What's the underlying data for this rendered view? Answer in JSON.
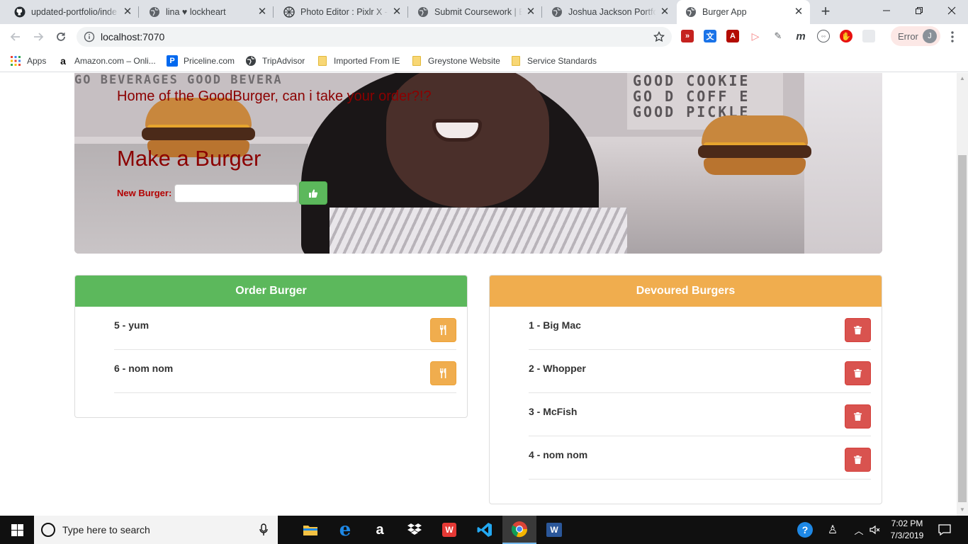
{
  "browser": {
    "tabs": [
      {
        "title": "updated-portfolio/inde",
        "favicon": "github-icon",
        "active": false
      },
      {
        "title": "lina ♥ lockheart",
        "favicon": "globe-icon",
        "active": false
      },
      {
        "title": "Photo Editor : Pixlr X - f",
        "favicon": "pixlr-icon",
        "active": false
      },
      {
        "title": "Submit Coursework | Bo",
        "favicon": "globe-icon",
        "active": false
      },
      {
        "title": "Joshua Jackson Portfoli",
        "favicon": "globe-icon",
        "active": false
      },
      {
        "title": "Burger App",
        "favicon": "globe-icon",
        "active": true
      }
    ],
    "new_tab": "+",
    "url": "localhost:7070",
    "profile_status": "Error",
    "profile_initial": "J",
    "bookmarks": [
      {
        "label": "Apps",
        "icon": "apps-grid-icon"
      },
      {
        "label": "Amazon.com – Onli...",
        "icon": "amazon-icon"
      },
      {
        "label": "Priceline.com",
        "icon": "priceline-icon"
      },
      {
        "label": "TripAdvisor",
        "icon": "globe-icon"
      },
      {
        "label": "Imported From IE",
        "icon": "folder-icon"
      },
      {
        "label": "Greystone Website",
        "icon": "folder-icon"
      },
      {
        "label": "Service Standards",
        "icon": "folder-icon"
      }
    ]
  },
  "hero": {
    "tagline": "Home of the GoodBurger, can i take your order?!?",
    "title": "Make a Burger",
    "input_label": "New Burger:",
    "input_value": "",
    "submit_icon": "thumbs-up-icon",
    "sign_left": "GO BEVERAGES  GOOD BEVERA",
    "sign_right_lines": [
      "GOOD COOKIE",
      "GO D COFF E",
      "GOOD PICKLE"
    ]
  },
  "order_panel": {
    "heading": "Order Burger",
    "color": "#5cb85c",
    "items": [
      {
        "label": "5 - yum",
        "button_icon": "utensils-icon"
      },
      {
        "label": "6 - nom nom",
        "button_icon": "utensils-icon"
      }
    ]
  },
  "devoured_panel": {
    "heading": "Devoured Burgers",
    "color": "#f0ad4e",
    "items": [
      {
        "label": "1 - Big Mac",
        "button_icon": "trash-icon"
      },
      {
        "label": "2 - Whopper",
        "button_icon": "trash-icon"
      },
      {
        "label": "3 - McFish",
        "button_icon": "trash-icon"
      },
      {
        "label": "4 - nom nom",
        "button_icon": "trash-icon"
      }
    ]
  },
  "taskbar": {
    "search_placeholder": "Type here to search",
    "time": "7:02 PM",
    "date": "7/3/2019"
  },
  "colors": {
    "hero_text": "#8b0000",
    "success": "#5cb85c",
    "warning": "#f0ad4e",
    "danger": "#d9534f"
  }
}
